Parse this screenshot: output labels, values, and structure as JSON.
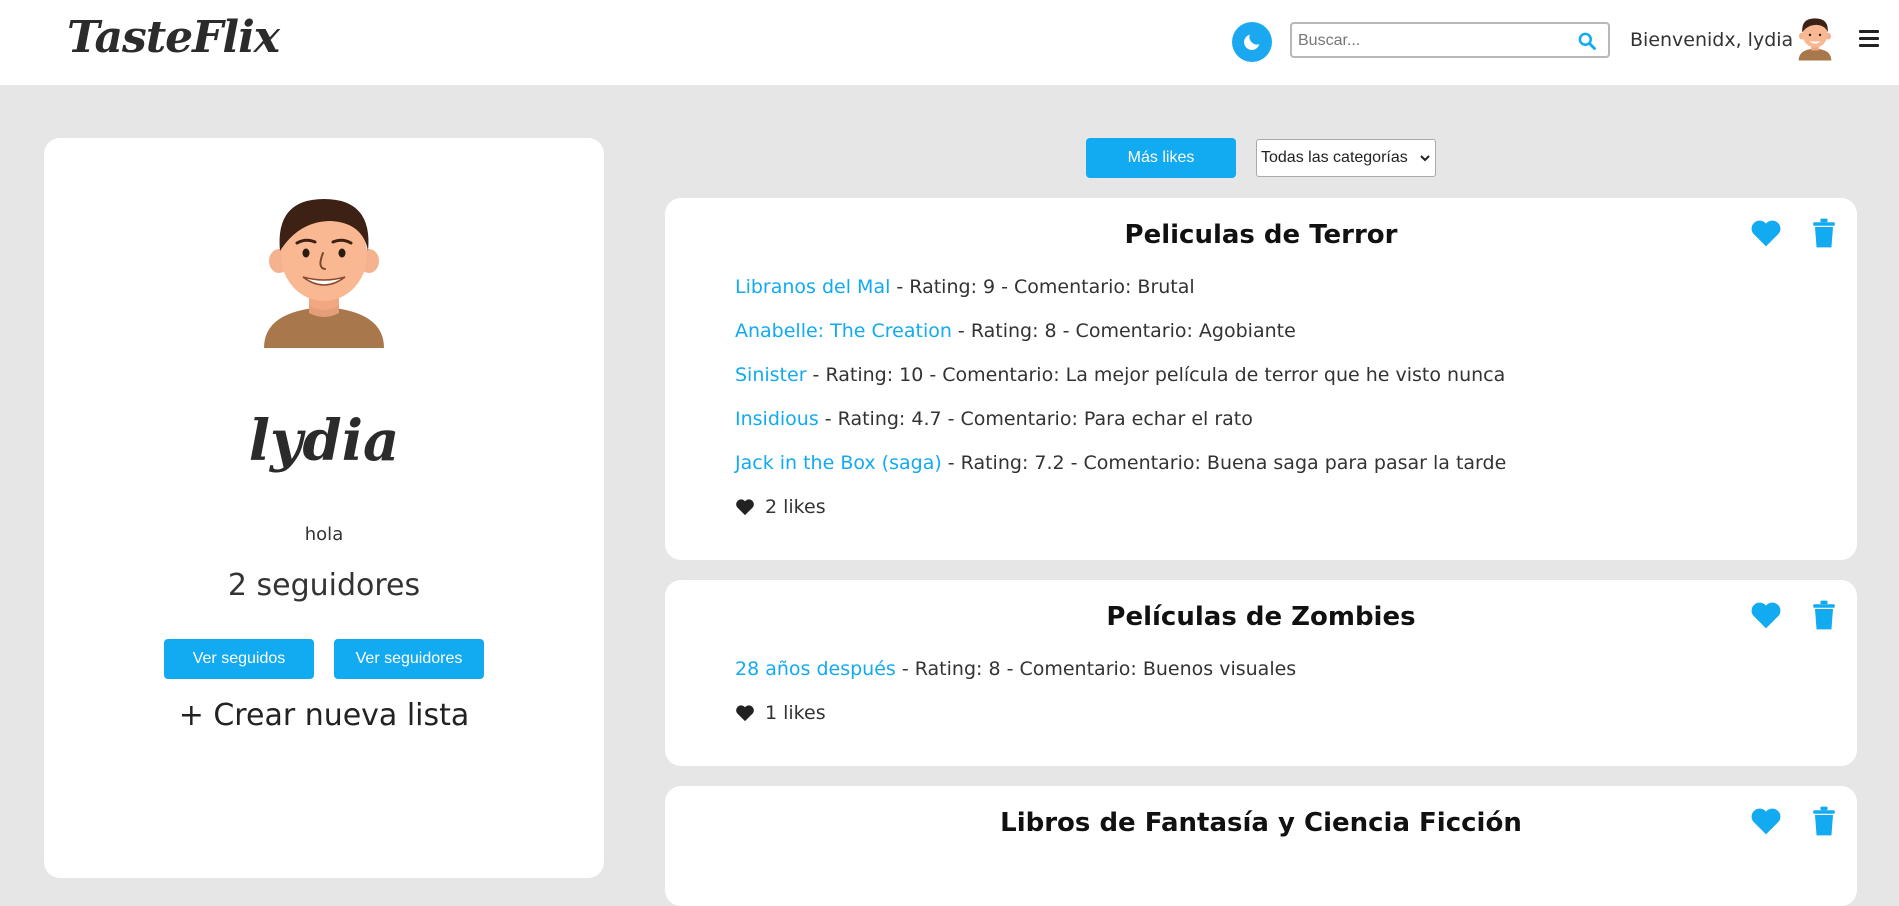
{
  "header": {
    "logo": "TasteFlix",
    "search_placeholder": "Buscar...",
    "welcome": "Bienvenidx, lydia"
  },
  "profile": {
    "name": "lydia",
    "bio": "hola",
    "followers": "2 seguidores",
    "following_button": "Ver seguidos",
    "followers_button": "Ver seguidores",
    "new_list": "+ Crear nueva lista"
  },
  "filters": {
    "sort_label": "Más likes",
    "category_selected": "Todas las categorías"
  },
  "colors": {
    "accent": "#12aaf0",
    "background": "#e6e6e6",
    "card": "#ffffff"
  },
  "icons": {
    "theme": "moon-icon",
    "search": "search-icon",
    "menu": "menu-icon",
    "like": "heart-icon",
    "delete": "trash-icon"
  },
  "lists": [
    {
      "title": "Peliculas de Terror",
      "items": [
        {
          "title": "Libranos del Mal",
          "details": " - Rating: 9 - Comentario: Brutal"
        },
        {
          "title": "Anabelle: The Creation",
          "details": " - Rating: 8 - Comentario: Agobiante"
        },
        {
          "title": "Sinister",
          "details": " - Rating: 10 - Comentario: La mejor película de terror que he visto nunca"
        },
        {
          "title": "Insidious",
          "details": " - Rating: 4.7 - Comentario: Para echar el rato"
        },
        {
          "title": "Jack in the Box (saga)",
          "details": " - Rating: 7.2 - Comentario: Buena saga para pasar la tarde"
        }
      ],
      "likes": "2 likes"
    },
    {
      "title": "Películas de Zombies",
      "items": [
        {
          "title": "28 años después",
          "details": " - Rating: 8 - Comentario: Buenos visuales"
        }
      ],
      "likes": "1 likes"
    },
    {
      "title": "Libros de Fantasía y Ciencia Ficción",
      "items": [],
      "likes": ""
    }
  ]
}
